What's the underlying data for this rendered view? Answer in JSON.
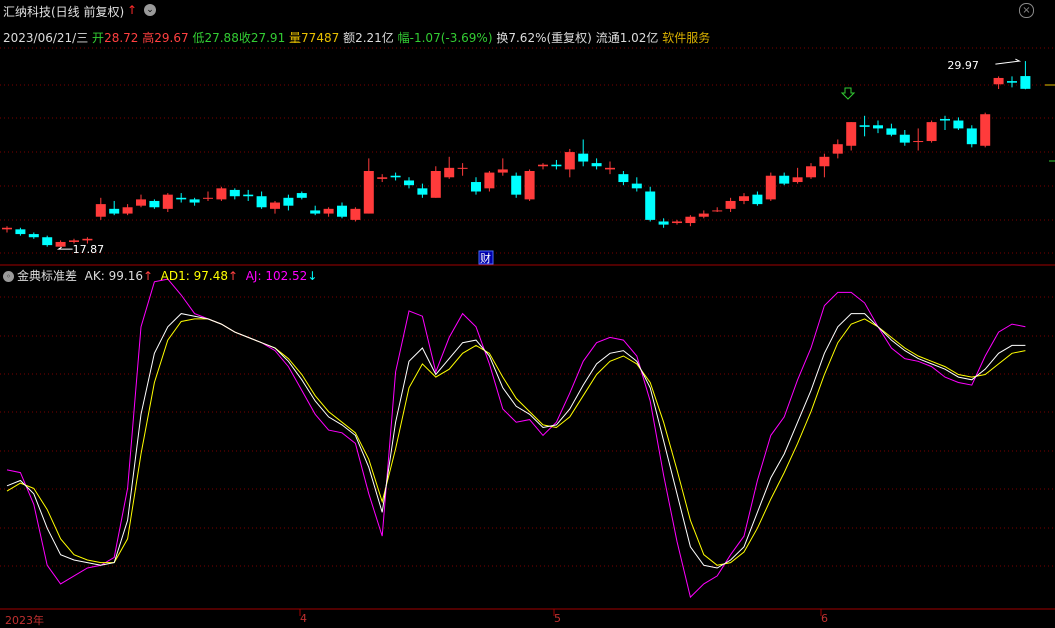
{
  "header": {
    "title": "汇纳科技(日线 前复权)",
    "up_arrow": "↑",
    "dropdown": "⌄",
    "close": "×"
  },
  "quote": {
    "date": "2023/06/21/三",
    "open_label": "开",
    "open": "28.72",
    "high_label": "高",
    "high": "29.67",
    "low_label": "低",
    "low": "27.88",
    "close_label": "收",
    "close": "27.91",
    "vol_label": "量",
    "vol": "77487",
    "amount_label": "额",
    "amount": "2.21亿",
    "change_label": "幅",
    "change": "-1.07(-3.69%)",
    "turnover": "换7.62%(重复权)",
    "float": "流通1.02亿",
    "service": "软件服务"
  },
  "price_panel": {
    "high_marker": "29.97",
    "low_marker": "17.87",
    "finance_badge": "财"
  },
  "indicator": {
    "name": "金典标准差",
    "ak_label": "AK:",
    "ak": "99.16",
    "ad1_label": "AD1:",
    "ad1": "97.48",
    "aj_label": "AJ:",
    "aj": "102.52",
    "ak_color": "#ffffff",
    "ad1_color": "#ffff00",
    "aj_color": "#ff00ff"
  },
  "time_axis": {
    "labels": [
      "2023年",
      "4",
      "5",
      "6"
    ]
  },
  "colors": {
    "up": "#ff3b3b",
    "down": "#00ffff",
    "grid": "#7a0000",
    "background": "#000000"
  },
  "candles": [
    [
      19.0,
      19.2,
      18.8,
      19.1
    ],
    [
      19.0,
      19.1,
      18.6,
      18.7
    ],
    [
      18.7,
      18.8,
      18.4,
      18.5
    ],
    [
      18.5,
      18.6,
      17.9,
      18.0
    ],
    [
      17.9,
      18.3,
      17.87,
      18.2
    ],
    [
      18.2,
      18.4,
      18.1,
      18.3
    ],
    [
      18.3,
      18.5,
      18.1,
      18.4
    ],
    [
      19.8,
      21.0,
      19.6,
      20.6
    ],
    [
      20.3,
      20.8,
      19.9,
      20.0
    ],
    [
      20.0,
      20.6,
      19.9,
      20.4
    ],
    [
      20.5,
      21.2,
      20.4,
      20.9
    ],
    [
      20.8,
      20.9,
      20.3,
      20.4
    ],
    [
      20.3,
      21.3,
      20.1,
      21.2
    ],
    [
      21.0,
      21.3,
      20.7,
      20.9
    ],
    [
      20.9,
      21.0,
      20.5,
      20.7
    ],
    [
      21.0,
      21.4,
      20.8,
      21.0
    ],
    [
      20.9,
      21.7,
      20.8,
      21.6
    ],
    [
      21.5,
      21.6,
      20.9,
      21.1
    ],
    [
      21.2,
      21.5,
      20.8,
      21.1
    ],
    [
      21.1,
      21.4,
      20.3,
      20.4
    ],
    [
      20.3,
      20.8,
      20.0,
      20.7
    ],
    [
      21.0,
      21.2,
      20.2,
      20.5
    ],
    [
      21.3,
      21.4,
      20.9,
      21.0
    ],
    [
      20.2,
      20.5,
      19.9,
      20.0
    ],
    [
      20.0,
      20.4,
      19.8,
      20.3
    ],
    [
      20.5,
      20.7,
      19.7,
      19.8
    ],
    [
      19.6,
      20.4,
      19.5,
      20.3
    ],
    [
      20.0,
      23.5,
      20.0,
      22.7
    ],
    [
      22.2,
      22.5,
      22.0,
      22.3
    ],
    [
      22.4,
      22.6,
      22.1,
      22.3
    ],
    [
      22.1,
      22.3,
      21.6,
      21.8
    ],
    [
      21.6,
      21.9,
      21.0,
      21.2
    ],
    [
      21.0,
      23.0,
      21.0,
      22.7
    ],
    [
      22.3,
      23.6,
      22.2,
      22.9
    ],
    [
      22.9,
      23.2,
      22.4,
      22.9
    ],
    [
      22.0,
      22.3,
      21.2,
      21.4
    ],
    [
      21.6,
      22.7,
      21.4,
      22.6
    ],
    [
      22.6,
      23.5,
      22.4,
      22.8
    ],
    [
      22.4,
      22.6,
      21.0,
      21.2
    ],
    [
      20.9,
      22.8,
      20.8,
      22.7
    ],
    [
      23.0,
      23.2,
      22.8,
      23.1
    ],
    [
      23.1,
      23.4,
      22.8,
      23.0
    ],
    [
      22.8,
      24.1,
      22.3,
      23.9
    ],
    [
      23.8,
      24.7,
      23.0,
      23.3
    ],
    [
      23.2,
      23.5,
      22.8,
      23.0
    ],
    [
      22.8,
      23.3,
      22.5,
      22.9
    ],
    [
      22.5,
      22.7,
      21.8,
      22.0
    ],
    [
      21.9,
      22.3,
      21.4,
      21.6
    ],
    [
      21.4,
      21.7,
      19.5,
      19.6
    ],
    [
      19.5,
      19.7,
      19.1,
      19.3
    ],
    [
      19.4,
      19.6,
      19.3,
      19.5
    ],
    [
      19.4,
      19.9,
      19.2,
      19.8
    ],
    [
      19.8,
      20.2,
      19.7,
      20.0
    ],
    [
      20.2,
      20.4,
      20.1,
      20.2
    ],
    [
      20.3,
      21.0,
      20.1,
      20.8
    ],
    [
      20.8,
      21.3,
      20.6,
      21.1
    ],
    [
      21.2,
      21.4,
      20.5,
      20.6
    ],
    [
      20.9,
      22.6,
      20.8,
      22.4
    ],
    [
      22.4,
      22.6,
      21.8,
      21.9
    ],
    [
      22.0,
      22.9,
      21.9,
      22.3
    ],
    [
      22.3,
      23.2,
      22.2,
      23.0
    ],
    [
      23.0,
      23.8,
      22.3,
      23.6
    ],
    [
      23.8,
      24.7,
      23.5,
      24.4
    ],
    [
      24.3,
      25.8,
      24.0,
      25.8
    ],
    [
      25.6,
      26.2,
      24.9,
      25.5
    ],
    [
      25.6,
      25.9,
      25.1,
      25.4
    ],
    [
      25.4,
      25.7,
      24.9,
      25.0
    ],
    [
      25.0,
      25.3,
      24.3,
      24.5
    ],
    [
      24.6,
      25.4,
      24.0,
      24.6
    ],
    [
      24.6,
      25.9,
      24.5,
      25.8
    ],
    [
      26.0,
      26.2,
      25.3,
      25.9
    ],
    [
      25.9,
      26.1,
      25.3,
      25.4
    ],
    [
      25.4,
      25.6,
      24.2,
      24.4
    ],
    [
      24.3,
      26.4,
      24.2,
      26.3
    ],
    [
      28.2,
      28.7,
      27.9,
      28.6
    ],
    [
      28.4,
      28.7,
      28.0,
      28.3
    ],
    [
      28.72,
      29.67,
      27.88,
      27.91
    ]
  ],
  "ak_series": [
    38,
    40,
    35,
    22,
    12,
    10,
    9,
    8,
    9,
    25,
    65,
    88,
    98,
    103,
    102,
    101,
    99,
    96,
    94,
    92,
    90,
    85,
    78,
    70,
    64,
    61,
    57,
    45,
    28,
    62,
    85,
    90,
    80,
    86,
    92,
    93,
    87,
    75,
    68,
    65,
    60,
    61,
    67,
    76,
    84,
    88,
    89,
    85,
    75,
    55,
    35,
    15,
    8,
    7,
    10,
    15,
    28,
    41,
    50,
    62,
    74,
    88,
    98,
    103,
    103,
    98,
    93,
    89,
    86,
    84,
    82,
    79,
    78,
    82,
    88,
    91,
    91
  ],
  "ad1_series": [
    36,
    39,
    37,
    29,
    18,
    12,
    10,
    9,
    9,
    18,
    50,
    77,
    93,
    100,
    101,
    101,
    99,
    96,
    94,
    92,
    90,
    86,
    80,
    72,
    66,
    62,
    58,
    48,
    32,
    52,
    75,
    84,
    79,
    82,
    88,
    91,
    88,
    79,
    71,
    66,
    61,
    60,
    64,
    72,
    80,
    85,
    87,
    84,
    77,
    62,
    44,
    25,
    12,
    8,
    9,
    13,
    22,
    33,
    43,
    54,
    66,
    80,
    92,
    99,
    101,
    98,
    94,
    90,
    87,
    85,
    83,
    80,
    79,
    80,
    84,
    88,
    89
  ],
  "aj_series": [
    44,
    43,
    31,
    8,
    1,
    4,
    7,
    8,
    11,
    37,
    98,
    115,
    116,
    110,
    103,
    101,
    99,
    96,
    94,
    92,
    89,
    83,
    74,
    65,
    59,
    58,
    54,
    35,
    19,
    81,
    104,
    102,
    81,
    94,
    103,
    98,
    84,
    67,
    62,
    63,
    57,
    62,
    73,
    85,
    92,
    94,
    93,
    87,
    70,
    42,
    17,
    -4,
    1,
    4,
    12,
    19,
    40,
    57,
    64,
    78,
    90,
    106,
    111,
    111,
    107,
    98,
    90,
    86,
    85,
    83,
    79,
    77,
    76,
    87,
    96,
    99,
    98
  ]
}
